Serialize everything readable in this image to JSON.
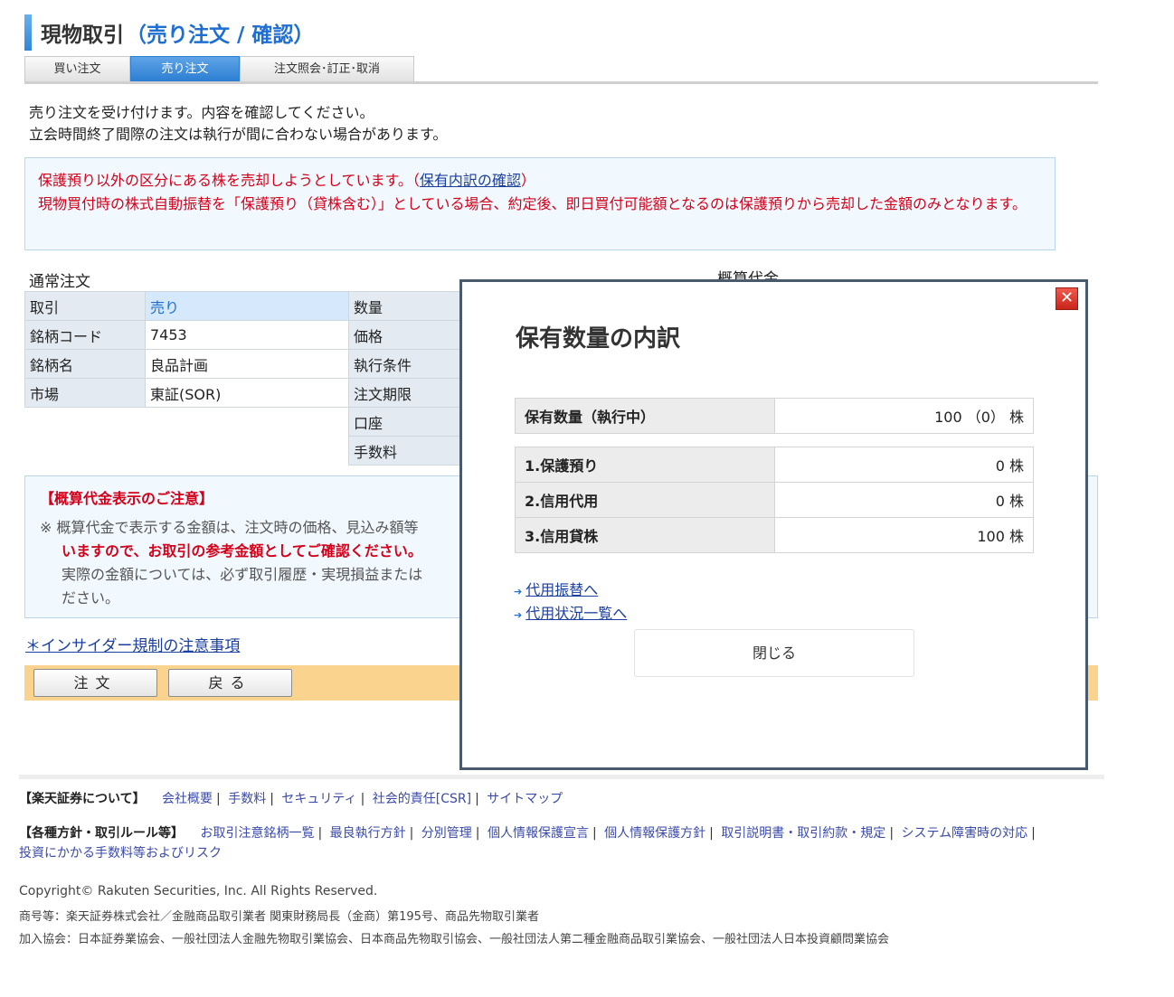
{
  "header": {
    "title": "現物取引",
    "subtitle": "（売り注文 / 確認）"
  },
  "tabs": [
    {
      "label": "買い注文"
    },
    {
      "label": "売り注文",
      "active": true
    },
    {
      "label": "注文照会･訂正･取消"
    }
  ],
  "intro": {
    "line1": "売り注文を受け付けます。内容を確認してください。",
    "line2": "立会時間終了間際の注文は執行が間に合わない場合があります。"
  },
  "warning": {
    "line1_text": "保護預り以外の区分にある株を売却しようとしています。（",
    "line1_link": "保有内訳の確認",
    "line1_close": "）",
    "line2": "現物買付時の株式自動振替を「保護預り（貸株含む）」としている場合、約定後、即日買付可能額となるのは保護預りから売却した金額のみとなります。"
  },
  "order": {
    "section_title": "通常注文",
    "estimate_title": "概算代金",
    "left_rows": [
      {
        "label": "取引",
        "value": "売り"
      },
      {
        "label": "銘柄コード",
        "value": "7453"
      },
      {
        "label": "銘柄名",
        "value": "良品計画"
      },
      {
        "label": "市場",
        "value": "東証(SOR)"
      }
    ],
    "right_labels": [
      "数量",
      "価格",
      "執行条件",
      "注文期限",
      "口座",
      "手数料"
    ]
  },
  "caution": {
    "head": "【概算代金表示のご注意】",
    "mark": "※",
    "line1": "概算代金で表示する金額は、注文時の価格、見込み額等",
    "line2_red": "いますので、お取引の参考金額としてご確認ください。",
    "line3": "実際の金額については、必ず取引履歴・実現損益または",
    "line4": "ださい。"
  },
  "insider_link": "＊インサイダー規制の注意事項",
  "buttons": {
    "order": "注文",
    "back": "戻る"
  },
  "footer": {
    "about_head": "【楽天証券について】",
    "about_links": [
      "会社概要",
      "手数料",
      "セキュリティ",
      "社会的責任[CSR]",
      "サイトマップ"
    ],
    "rules_head": "【各種方針・取引ルール等】",
    "rules_links": [
      "お取引注意銘柄一覧",
      "最良執行方針",
      "分別管理",
      "個人情報保護宣言",
      "個人情報保護方針",
      "取引説明書・取引約款・規定",
      "システム障害時の対応"
    ],
    "rules_links2": [
      "投資にかかる手数料等およびリスク"
    ],
    "copyright": "Copyright© Rakuten Securities, Inc. All Rights Reserved.",
    "company": "商号等：楽天証券株式会社／金融商品取引業者 関東財務局長（金商）第195号、商品先物取引業者",
    "associations": "加入協会：日本証券業協会、一般社団法人金融先物取引業協会、日本商品先物取引協会、一般社団法人第二種金融商品取引業協会、一般社団法人日本投資顧問業協会"
  },
  "modal": {
    "close_x": "✕",
    "title": "保有数量の内訳",
    "total": {
      "label": "保有数量（執行中）",
      "value": "100 （0） 株"
    },
    "rows": [
      {
        "label": "1.保護預り",
        "value": "0 株"
      },
      {
        "label": "2.信用代用",
        "value": "0 株"
      },
      {
        "label": "3.信用貸株",
        "value": "100 株"
      }
    ],
    "link1": "代用振替へ",
    "link2": "代用状況一覧へ",
    "close_button": "閉じる"
  }
}
